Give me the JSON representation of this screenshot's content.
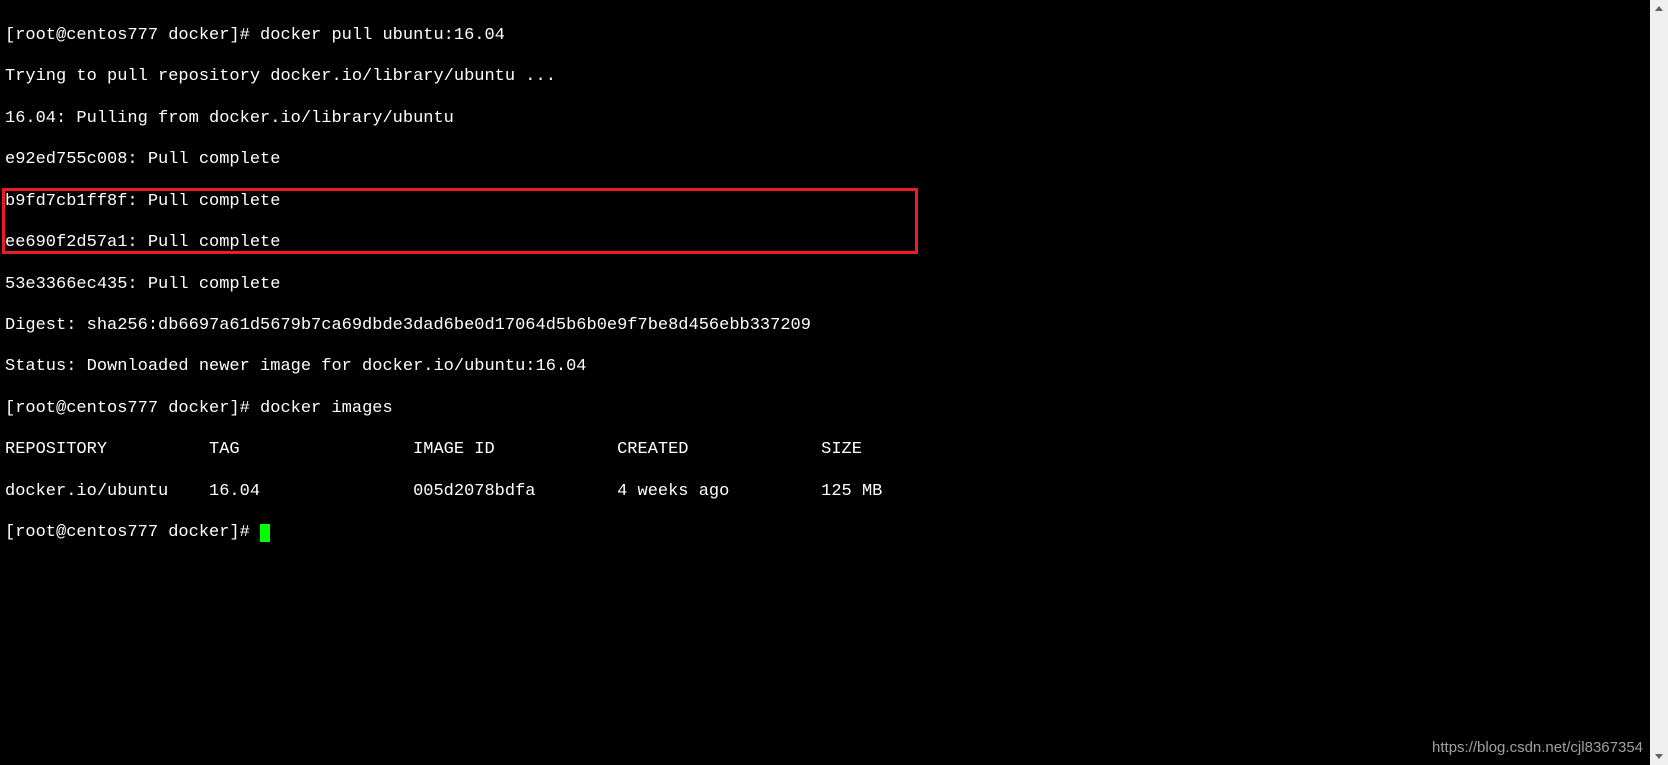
{
  "terminal": {
    "prompt1": "[root@centos777 docker]# ",
    "cmd_pull": "docker pull ubuntu:16.04",
    "output_lines": [
      "Trying to pull repository docker.io/library/ubuntu ...",
      "16.04: Pulling from docker.io/library/ubuntu",
      "e92ed755c008: Pull complete",
      "b9fd7cb1ff8f: Pull complete",
      "ee690f2d57a1: Pull complete",
      "53e3366ec435: Pull complete",
      "Digest: sha256:db6697a61d5679b7ca69dbde3dad6be0d17064d5b6b0e9f7be8d456ebb337209",
      "Status: Downloaded newer image for docker.io/ubuntu:16.04"
    ],
    "prompt2": "[root@centos777 docker]# ",
    "cmd_images": "docker images",
    "table_header": "REPOSITORY          TAG                 IMAGE ID            CREATED             SIZE",
    "table_row": "docker.io/ubuntu    16.04               005d2078bdfa        4 weeks ago         125 MB",
    "prompt3": "[root@centos777 docker]# "
  },
  "watermark": "https://blog.csdn.net/cjl8367354"
}
